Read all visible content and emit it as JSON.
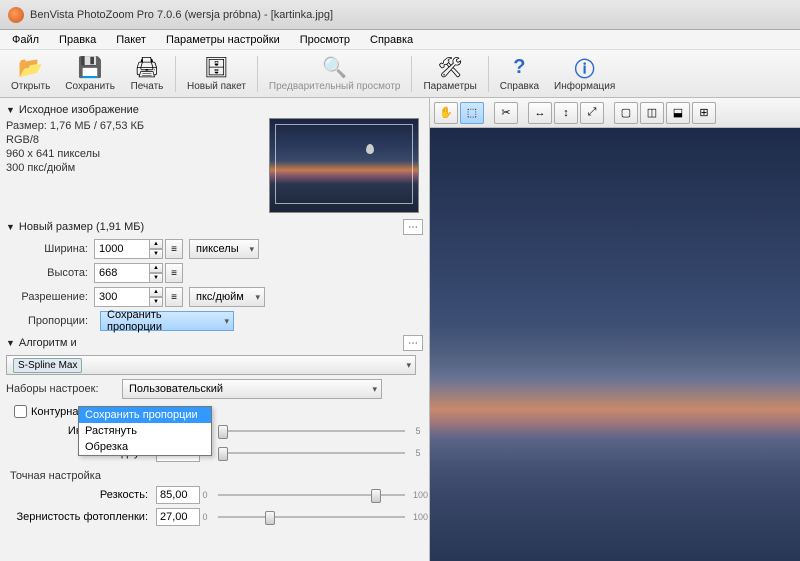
{
  "titlebar": {
    "title": "BenVista PhotoZoom Pro 7.0.6 (wersja próbna) - [kartinka.jpg]"
  },
  "menu": {
    "file": "Файл",
    "edit": "Правка",
    "batch": "Пакет",
    "settings": "Параметры настройки",
    "view": "Просмотр",
    "help": "Справка"
  },
  "toolbar": {
    "open": "Открыть",
    "save": "Сохранить",
    "print": "Печать",
    "newbatch": "Новый пакет",
    "preview": "Предварительный просмотр",
    "params": "Параметры",
    "helpbtn": "Справка",
    "info": "Информация"
  },
  "source": {
    "header": "Исходное изображение",
    "size": "Размер: 1,76 МБ / 67,53 КБ",
    "mode": "RGB/8",
    "dims": "960 x 641 пикселы",
    "dpi": "300 пкс/дюйм"
  },
  "newsize": {
    "header": "Новый размер (1,91 МБ)",
    "width_lbl": "Ширина:",
    "width": "1000",
    "height_lbl": "Высота:",
    "height": "668",
    "res_lbl": "Разрешение:",
    "res": "300",
    "unit_px": "пикселы",
    "unit_dpi": "пкс/дюйм",
    "prop_lbl": "Пропорции:",
    "prop_val": "Сохранить пропорции",
    "prop_opts": {
      "keep": "Сохранить пропорции",
      "stretch": "Растянуть",
      "crop": "Обрезка"
    }
  },
  "algo": {
    "header": "Алгоритм и",
    "method": "S-Spline Max"
  },
  "presets": {
    "lbl": "Наборы настроек:",
    "val": "Пользовательский"
  },
  "contour": {
    "chk": "Контурная резкость",
    "intensity": "Интенсивность:",
    "radius": "Радиус:"
  },
  "fine": {
    "header": "Точная настройка",
    "sharp_lbl": "Резкость:",
    "sharp": "85,00",
    "grain_lbl": "Зернистость фотопленки:",
    "grain": "27,00"
  },
  "scale": {
    "min": "0",
    "max": "5",
    "max100": "100"
  }
}
